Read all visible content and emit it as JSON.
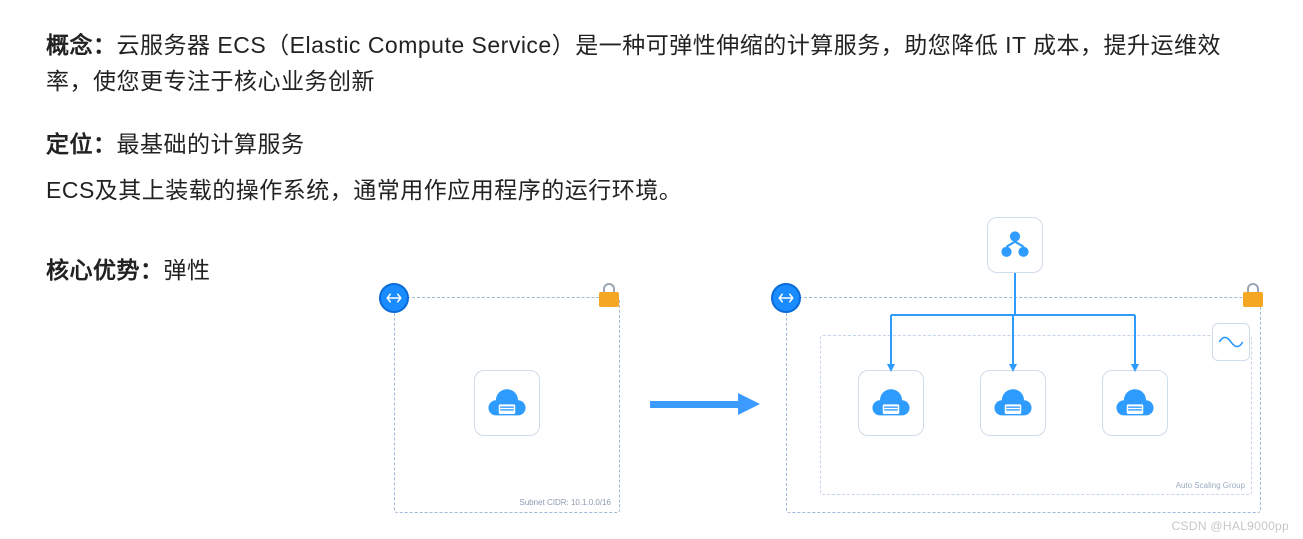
{
  "paragraphs": {
    "p1_label": "概念：",
    "p1_text": "云服务器 ECS（Elastic Compute Service）是一种可弹性伸缩的计算服务，助您降低 IT 成本，提升运维效率，使您更专注于核心业务创新",
    "p2_label": "定位：",
    "p2_text": "最基础的计算服务",
    "p3_text": "ECS及其上装载的操作系统，通常用作应用程序的运行环境。",
    "p4_label": "核心优势：",
    "p4_text": "弹性"
  },
  "diagram": {
    "subnet_label_left": "Subnet CIDR: 10.1.0.0/16",
    "group_label": "Auto Scaling Group",
    "icons": {
      "internet_badge": "internet-gateway-icon",
      "lock": "lock-icon",
      "cloud_server": "ecs-server-icon",
      "load_balancer": "load-balancer-icon",
      "wave": "scaling-wave-icon",
      "arrow": "expand-arrow-icon"
    }
  },
  "watermark": "CSDN @HAL9000pp"
}
